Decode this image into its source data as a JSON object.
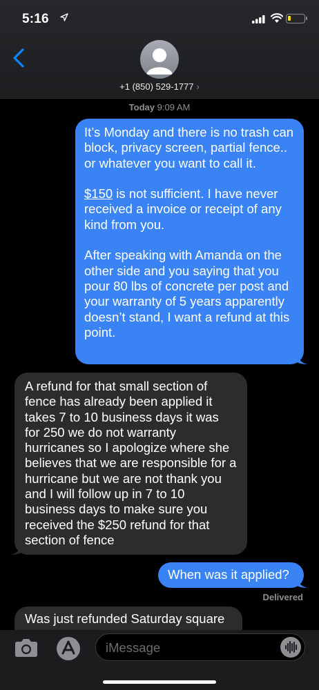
{
  "status_bar": {
    "time": "5:16"
  },
  "header": {
    "contact_number": "+1 (850) 529-1777",
    "contact_chevron": "›"
  },
  "timestamp": {
    "day": "Today",
    "time": "9:09 AM"
  },
  "messages": [
    {
      "direction": "sent",
      "paragraphs": [
        "It’s Monday and there is no trash can block, privacy screen, partial fence.. or whatever you want to call it.",
        "$150 is not sufficient. I have never received a invoice or receipt of any kind from you.",
        "After speaking with Amanda on the other side and you saying that you pour 80 lbs of concrete per post and your warranty of 5 years apparently doesn’t stand, I want a refund at this point."
      ],
      "underlined_amount": "$150",
      "p2_rest": " is not sufficient. I have never received a invoice or receipt of any kind from you."
    },
    {
      "direction": "received",
      "text": "A refund for that small section of fence has already been applied it takes 7 to 10 business days it was for 250 we do not warranty hurricanes so I apologize where she believes that we are responsible for a hurricane but we are not thank you and I will follow up in 7 to 10 business days to make sure you received the $250 refund for that section of fence"
    },
    {
      "direction": "sent",
      "text": "When was it applied?"
    },
    {
      "direction": "received",
      "text": "Was just refunded Saturday square"
    }
  ],
  "delivered_label": "Delivered",
  "compose": {
    "placeholder": "iMessage"
  },
  "colors": {
    "sent_bubble": "#3a83f5",
    "received_bubble": "#2c2c2e",
    "accent": "#0a84ff",
    "battery": "#ffd60a"
  },
  "icons": [
    "location-arrow-icon",
    "cellular-signal-icon",
    "wifi-icon",
    "battery-icon",
    "back-chevron-icon",
    "contact-avatar-icon",
    "camera-icon",
    "app-store-icon",
    "audio-waveform-icon"
  ]
}
